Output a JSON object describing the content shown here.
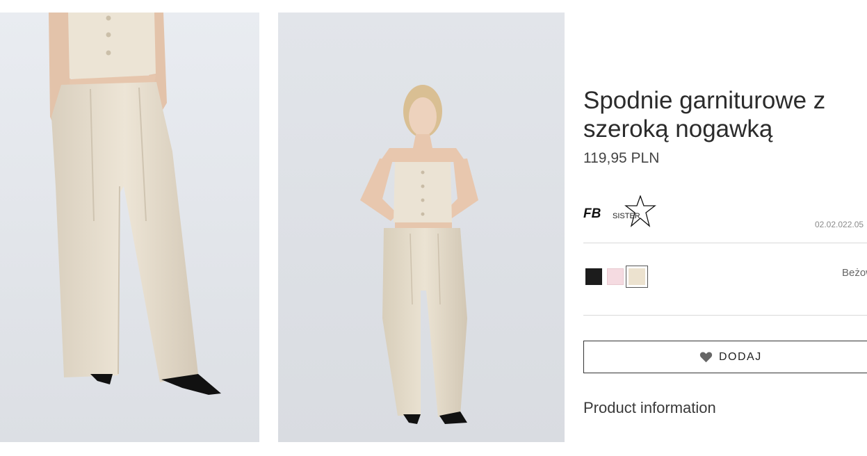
{
  "gallery": {
    "images": [
      {
        "alt": "Spodnie garniturowe z szeroką nogawką - close up"
      },
      {
        "alt": "Spodnie garniturowe z szeroką nogawką - full length"
      }
    ]
  },
  "product": {
    "title": "Spodnie garniturowe z szeroką nogawką",
    "price": "119,95 PLN",
    "brand": {
      "logo_text": "FB",
      "logo_sub": "SISTER"
    },
    "sku": "02.02.022.05",
    "colors": [
      {
        "name": "black",
        "hex": "#1c1c1c"
      },
      {
        "name": "pink",
        "hex": "#f5dbe1"
      },
      {
        "name": "beige",
        "hex": "#ece2cf",
        "selected": true
      }
    ],
    "selected_color_label": "Beżowy",
    "add_button_label": "DODAJ",
    "product_info_label": "Product information"
  },
  "icons": {
    "wishlist": "heart-icon",
    "brand": "star-icon"
  }
}
